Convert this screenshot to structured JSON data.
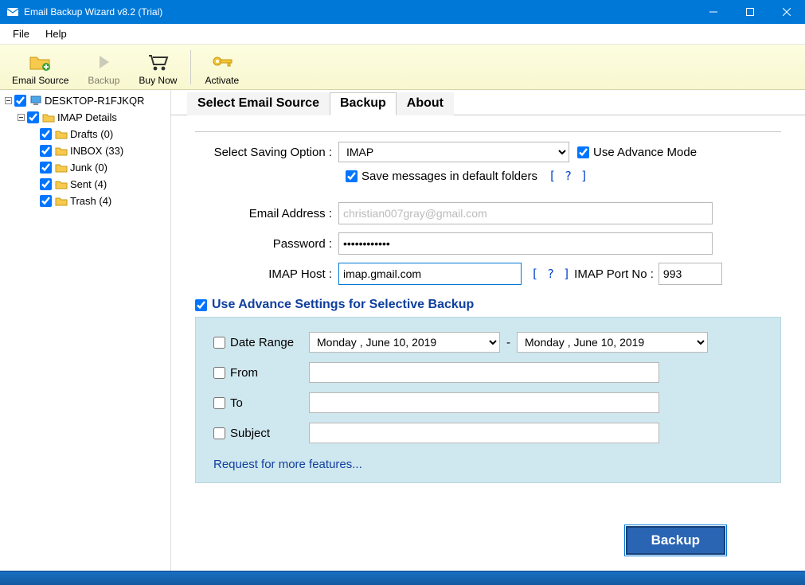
{
  "window": {
    "title": "Email Backup Wizard v8.2 (Trial)"
  },
  "menu": {
    "file": "File",
    "help": "Help"
  },
  "toolbar": {
    "email_source": "Email Source",
    "backup": "Backup",
    "buy_now": "Buy Now",
    "activate": "Activate"
  },
  "tree": {
    "root": "DESKTOP-R1FJKQR",
    "imap": "IMAP Details",
    "folders": [
      {
        "name": "Drafts (0)"
      },
      {
        "name": "INBOX (33)"
      },
      {
        "name": "Junk (0)"
      },
      {
        "name": "Sent (4)"
      },
      {
        "name": "Trash (4)"
      }
    ]
  },
  "tabs": {
    "select_source": "Select Email Source",
    "backup": "Backup",
    "about": "About"
  },
  "backup": {
    "saving_option_label": "Select Saving Option :",
    "saving_option_value": "IMAP",
    "use_advance_mode": "Use Advance Mode",
    "save_default": "Save messages in default folders",
    "help": "[ ? ]",
    "email_label": "Email Address :",
    "email_value": "christian007gray@gmail.com",
    "password_label": "Password :",
    "password_value": "••••••••••••",
    "host_label": "IMAP Host :",
    "host_value": "imap.gmail.com",
    "port_label": "IMAP Port No :",
    "port_value": "993",
    "adv_settings_label": "Use Advance Settings for Selective Backup",
    "date_range": "Date Range",
    "date_start": "Monday    ,       June      10, 2019",
    "date_end": "Monday    ,       June      10, 2019",
    "from": "From",
    "to": "To",
    "subject": "Subject",
    "request_link": "Request for more features...",
    "backup_button": "Backup"
  }
}
